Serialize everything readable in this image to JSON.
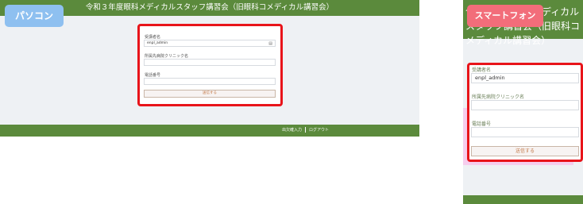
{
  "badges": {
    "pc": "パソコン",
    "smartphone": "スマートフォン"
  },
  "title": "令和３年度眼科メディカルスタッフ講習会（旧眼科コメディカル講習会）",
  "form": {
    "field1_label": "受講者名",
    "field1_value": "enpl_admin",
    "field2_label": "所属先病院クリニック名",
    "field2_value": "",
    "field3_label": "電話番号",
    "field3_value": "",
    "submit_label": "送信する"
  },
  "footer": {
    "link1": "出欠確入力",
    "link2": "ログアウト"
  },
  "colors": {
    "header": "#5b8a3c",
    "highlight_border": "#e8141a",
    "badge_pc": "#8ec0f0",
    "badge_sp": "#f26d7a"
  }
}
